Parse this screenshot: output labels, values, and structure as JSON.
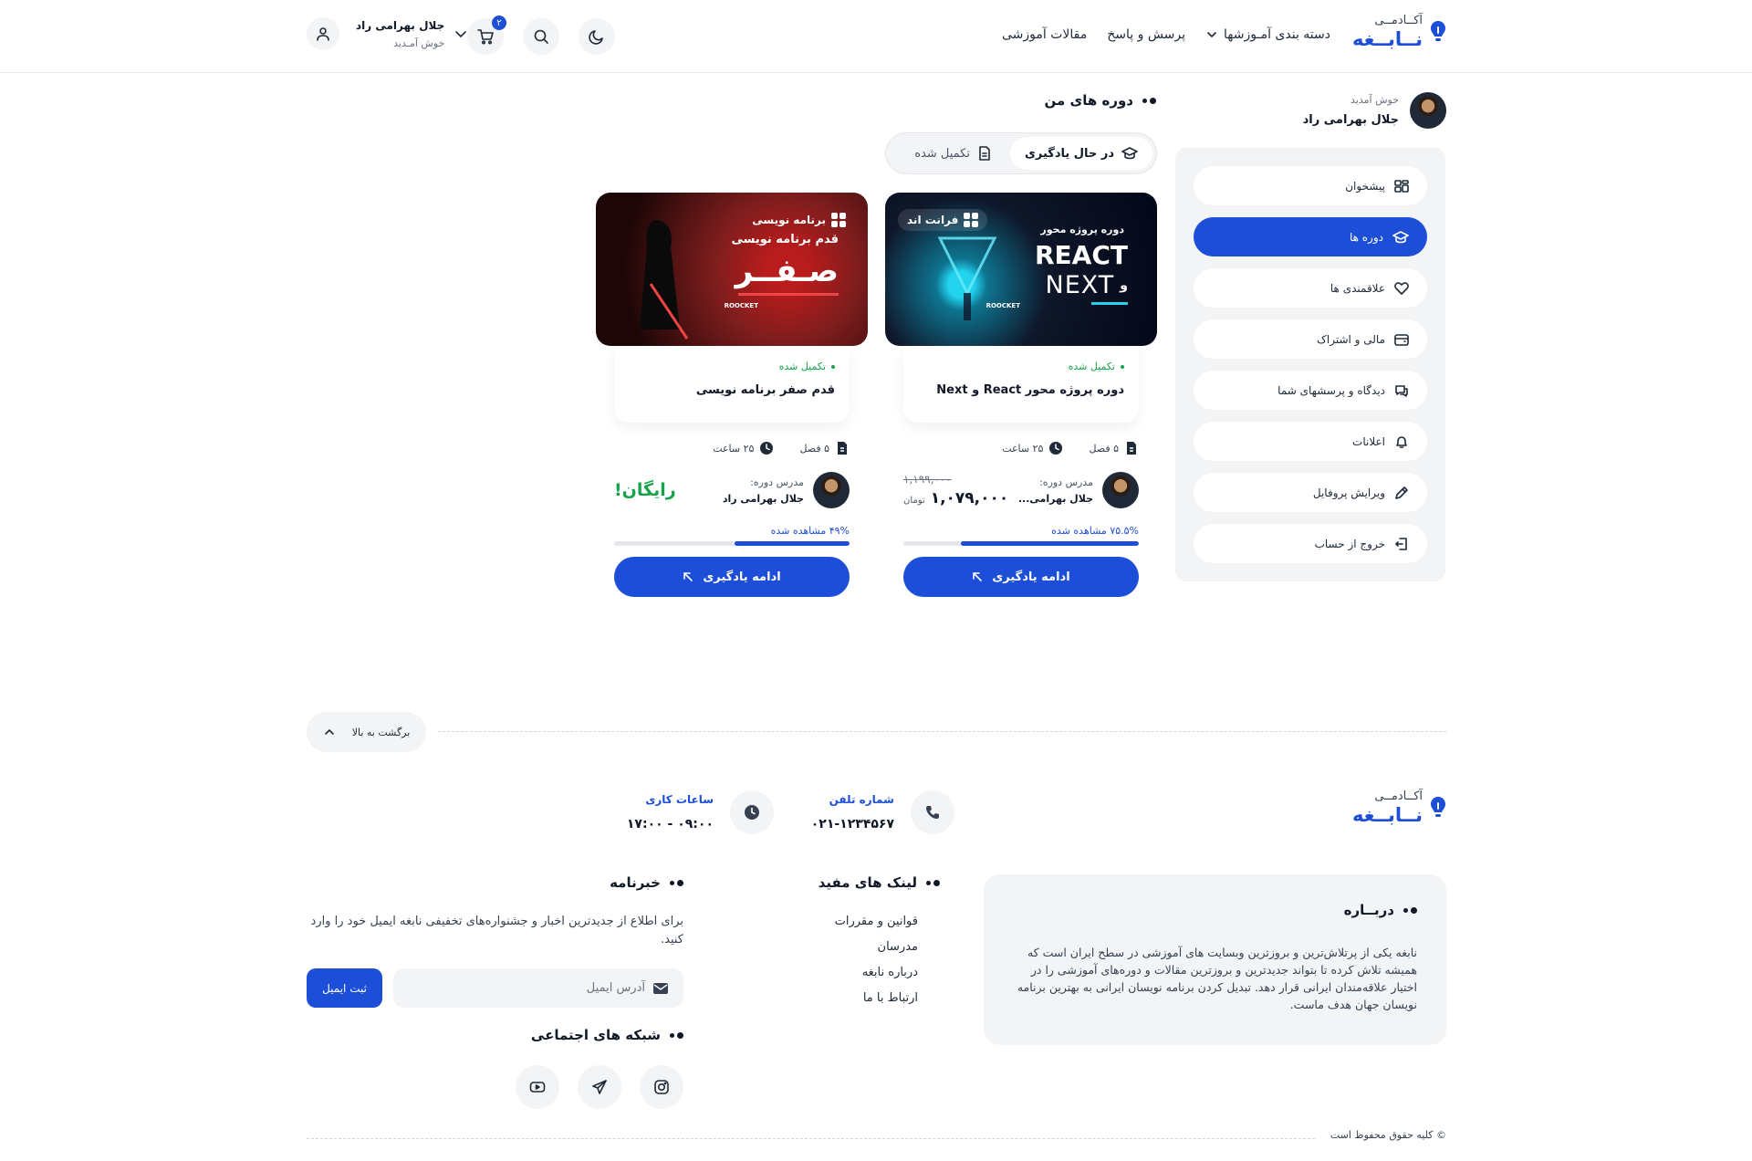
{
  "header": {
    "logo_small": "آکــادمــی",
    "logo_big": "نــابــغه",
    "nav": {
      "categories": "دسته بندی آمـوزشها",
      "qa": "پرسش و پاسخ",
      "articles": "مقالات آموزشی"
    },
    "cart_count": "۲",
    "user_name": "جلال بهرامی راد",
    "user_greeting": "خوش آمـدید"
  },
  "profile": {
    "greeting": "خوش آمدید",
    "name": "جلال بهرامی راد"
  },
  "sidebar": {
    "items": [
      {
        "label": "پیشخوان",
        "icon": "dashboard-icon"
      },
      {
        "label": "دوره ها",
        "icon": "graduation-cap-icon",
        "active": true
      },
      {
        "label": "علاقمندی ها",
        "icon": "heart-icon"
      },
      {
        "label": "مالی و اشتراک",
        "icon": "wallet-icon"
      },
      {
        "label": "دیدگاه و پرسشهای شما",
        "icon": "chat-icon"
      },
      {
        "label": "اعلانات",
        "icon": "bell-icon"
      },
      {
        "label": "ویرایش پروفایل",
        "icon": "pencil-icon"
      },
      {
        "label": "خروج از حساب",
        "icon": "logout-icon"
      }
    ]
  },
  "main": {
    "title": "دوره های من",
    "tabs": {
      "learning": "در حال یادگیری",
      "completed": "تکمیل شده"
    },
    "cards": [
      {
        "tag": "فرانت اند",
        "banner_line1": "دوره پروژه محور",
        "banner_line2": "REACT",
        "banner_line3": "NEXT",
        "banner_and": "و",
        "banner_brand": "ROOCKET",
        "status": "تکمیل شده",
        "title": "دوره پروژه محور React و Next",
        "chapters": "۵ فصل",
        "hours": "۲۵ ساعت",
        "teacher_label": "مدرس دوره:",
        "teacher_name": "جلال بهرامی...",
        "price_old": "۱,۱۹۹,۰۰۰",
        "price_new": "۱,۰۷۹,۰۰۰",
        "currency": "تومان",
        "progress_label": "۷۵.۵% مشاهده شده",
        "progress": 0.755,
        "cta": "ادامه یادگیری"
      },
      {
        "tag": "برنامه نویسی",
        "banner_line1": "قدم برنامه نویسی",
        "banner_line2": "صـفــر",
        "banner_brand": "ROOCKET",
        "status": "تکمیل شده",
        "title": "قدم صفر برنامه نویسی",
        "chapters": "۵ فصل",
        "hours": "۲۵ ساعت",
        "teacher_label": "مدرس دوره:",
        "teacher_name": "جلال بهرامی راد",
        "price_free": "رایگان!",
        "progress_label": "۴۹% مشاهده شده",
        "progress": 0.49,
        "cta": "ادامه یادگیری"
      }
    ]
  },
  "footer": {
    "back_to_top": "برگشت به بالا",
    "logo_small": "آکــادمــی",
    "logo_big": "نــابــغه",
    "phone_label": "شماره تلفن",
    "phone_value": "۰۲۱-۱۲۳۴۵۶۷",
    "hours_label": "ساعات کاری",
    "hours_value": "۰۹:۰۰ - ۱۷:۰۰",
    "about_title": "دربــاره",
    "about_text": "نابغه یکی از پرتلاش‌ترین و بروزترین وبسایت های آموزشی در سطح ایران است که همیشه تلاش کرده تا بتواند جدیدترین و بروزترین مقالات و دوره‌های آموزشی را در اختیار علاقه‌مندان ایرانی قرار دهد. تبدیل کردن برنامه نویسان ایرانی به بهترین برنامه نویسان جهان هدف ماست.",
    "links_title": "لینک های مفید",
    "links": [
      "قوانین و مقررات",
      "مدرسان",
      "درباره نابغه",
      "ارتباط با ما"
    ],
    "newsletter_title": "خبرنامه",
    "newsletter_text": "برای اطلاع از جدیدترین اخبار و جشنواره‌های تخفیفی نابغه ایمیل خود را وارد کنید.",
    "email_placeholder": "آدرس ایمیل",
    "email_button": "ثبت ایمیل",
    "social_title": "شبکه های اجتماعی",
    "copyright": "© کلیه حقوق محفوظ است"
  }
}
